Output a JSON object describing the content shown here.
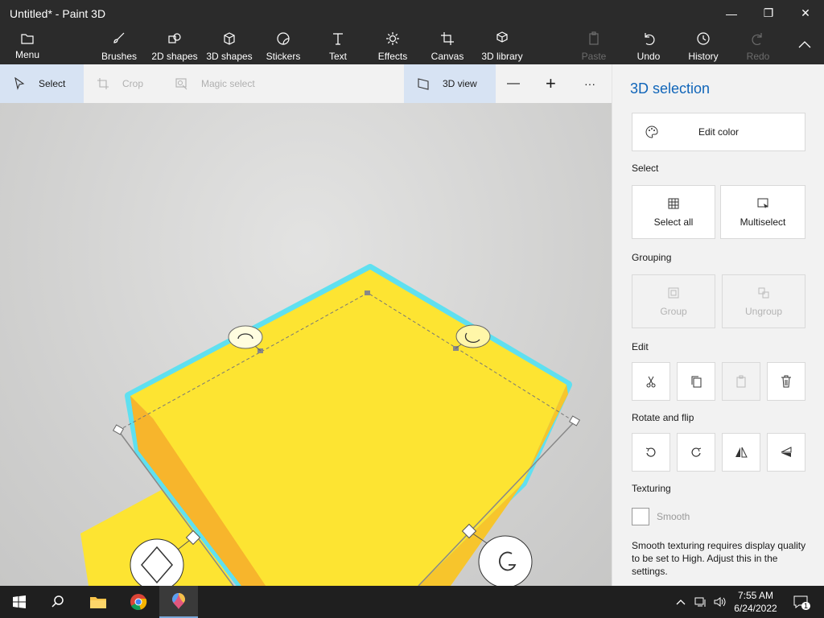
{
  "window": {
    "title": "Untitled* - Paint 3D",
    "minimize_glyph": "—",
    "restore_glyph": "❐",
    "close_glyph": "✕"
  },
  "ribbon": {
    "menu": "Menu",
    "brushes": "Brushes",
    "shapes2d": "2D shapes",
    "shapes3d": "3D shapes",
    "stickers": "Stickers",
    "text": "Text",
    "effects": "Effects",
    "canvas": "Canvas",
    "library3d": "3D library",
    "paste": "Paste",
    "undo": "Undo",
    "history": "History",
    "redo": "Redo"
  },
  "toolbar": {
    "select": "Select",
    "crop": "Crop",
    "magic_select": "Magic select",
    "view3d": "3D view",
    "zoom_out": "—",
    "zoom_in": "+",
    "more": "···"
  },
  "panel": {
    "title": "3D selection",
    "edit_color": "Edit color",
    "select_heading": "Select",
    "select_all": "Select all",
    "multiselect": "Multiselect",
    "grouping_heading": "Grouping",
    "group": "Group",
    "ungroup": "Ungroup",
    "edit_heading": "Edit",
    "rotate_heading": "Rotate and flip",
    "texturing_heading": "Texturing",
    "smooth": "Smooth",
    "smooth_checked": false,
    "note": "Smooth texturing requires display quality to be set to High. Adjust this in the settings."
  },
  "taskbar": {
    "time": "7:55 AM",
    "date": "6/24/2022",
    "notification_count": "1"
  },
  "colors": {
    "accent": "#1065b9",
    "shape_top": "#fde432",
    "shape_side": "#f7c52c",
    "selection_glow": "#5fe0f0"
  }
}
